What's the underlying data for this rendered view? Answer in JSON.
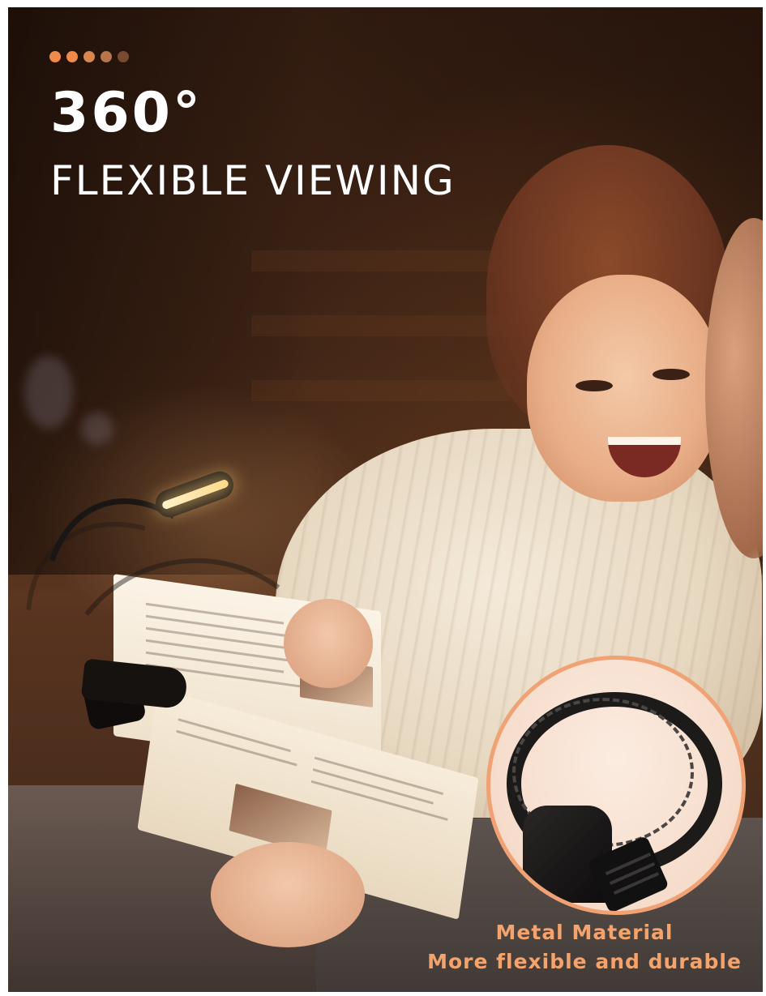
{
  "header": {
    "pager_dots": [
      {
        "color": "#f08a4b"
      },
      {
        "color": "#f08a4b"
      },
      {
        "color": "#d9874f"
      },
      {
        "color": "#b8744a"
      },
      {
        "color": "#7a4a30"
      }
    ],
    "headline": "360°",
    "subheadline": "FLEXIBLE VIEWING"
  },
  "feature": {
    "title": "Metal Material",
    "description": "More flexible and durable"
  },
  "colors": {
    "accent": "#f4a36c",
    "inset_border": "#f0a274",
    "text": "#ffffff"
  },
  "icons": {
    "lamp": "book-light-icon",
    "gooseneck": "gooseneck-closeup-icon"
  }
}
